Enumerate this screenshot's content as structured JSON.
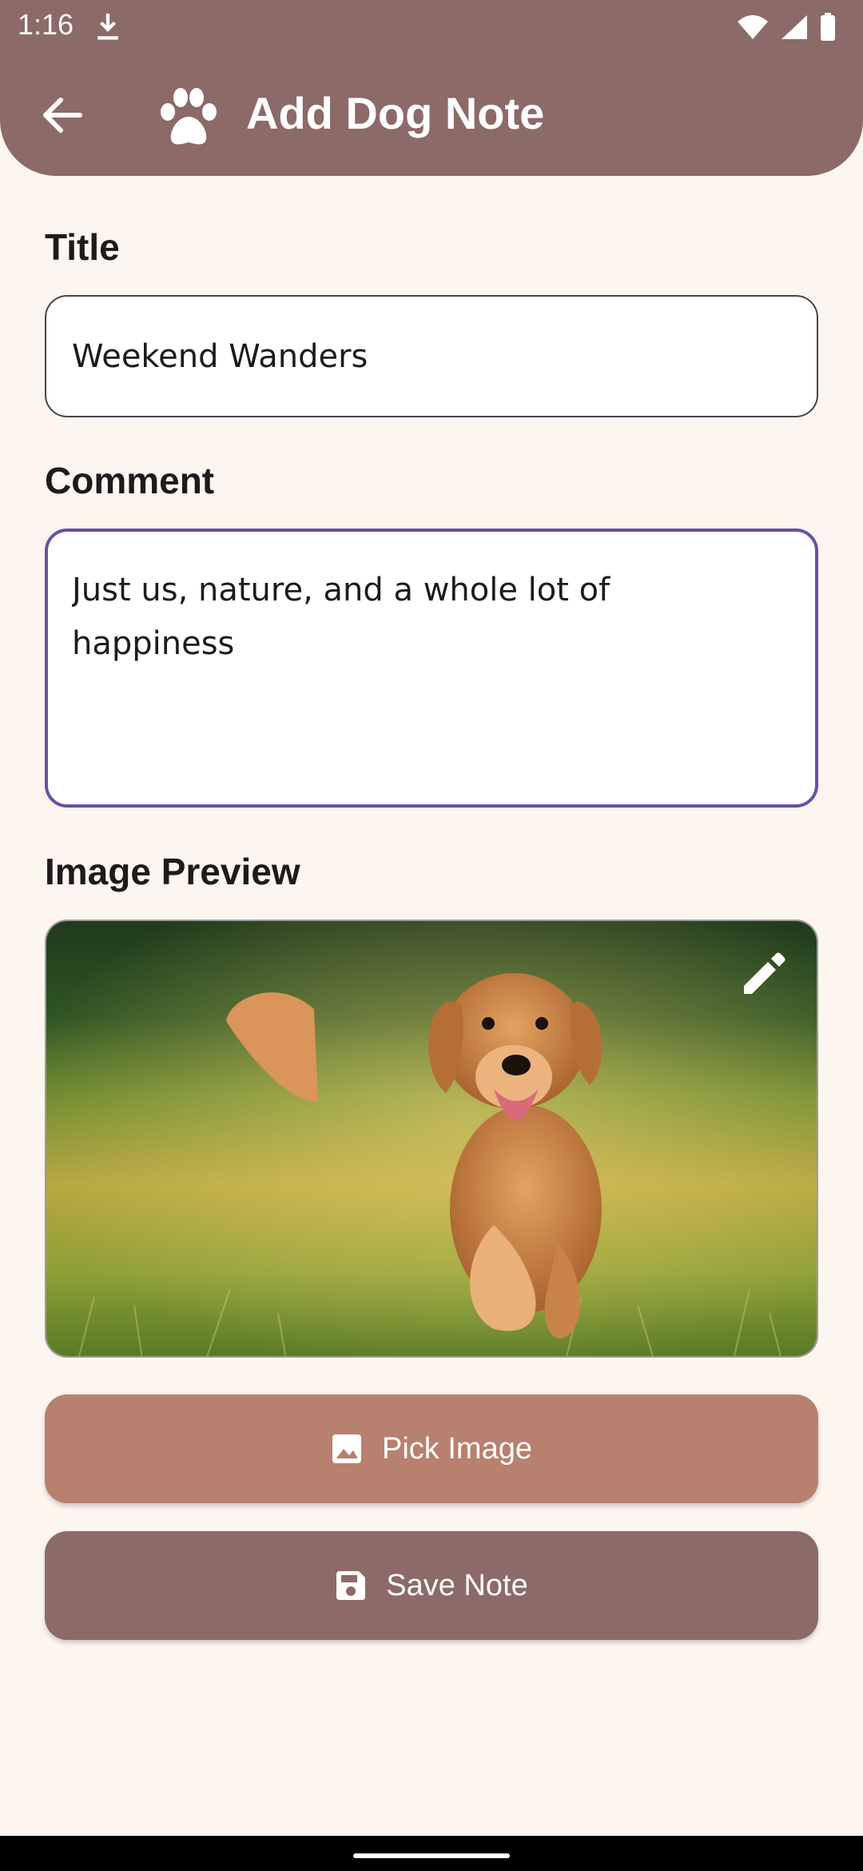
{
  "status_bar": {
    "time": "1:16"
  },
  "app_bar": {
    "title": "Add Dog Note"
  },
  "form": {
    "title_label": "Title",
    "title_value": "Weekend Wanders",
    "comment_label": "Comment",
    "comment_value": "Just us, nature, and a whole lot of happiness",
    "image_preview_label": "Image Preview"
  },
  "buttons": {
    "pick_image": "Pick Image",
    "save_note": "Save Note"
  },
  "colors": {
    "app_bar": "#8C6A67",
    "background": "#FDF5F0",
    "pick_button": "#B8806E",
    "save_button": "#8C6A67",
    "focused_outline": "#6750A4"
  },
  "icons": {
    "back": "arrow-back-icon",
    "paw": "paw-icon",
    "edit": "pencil-icon",
    "pick_image": "image-icon",
    "save": "floppy-disk-icon"
  }
}
